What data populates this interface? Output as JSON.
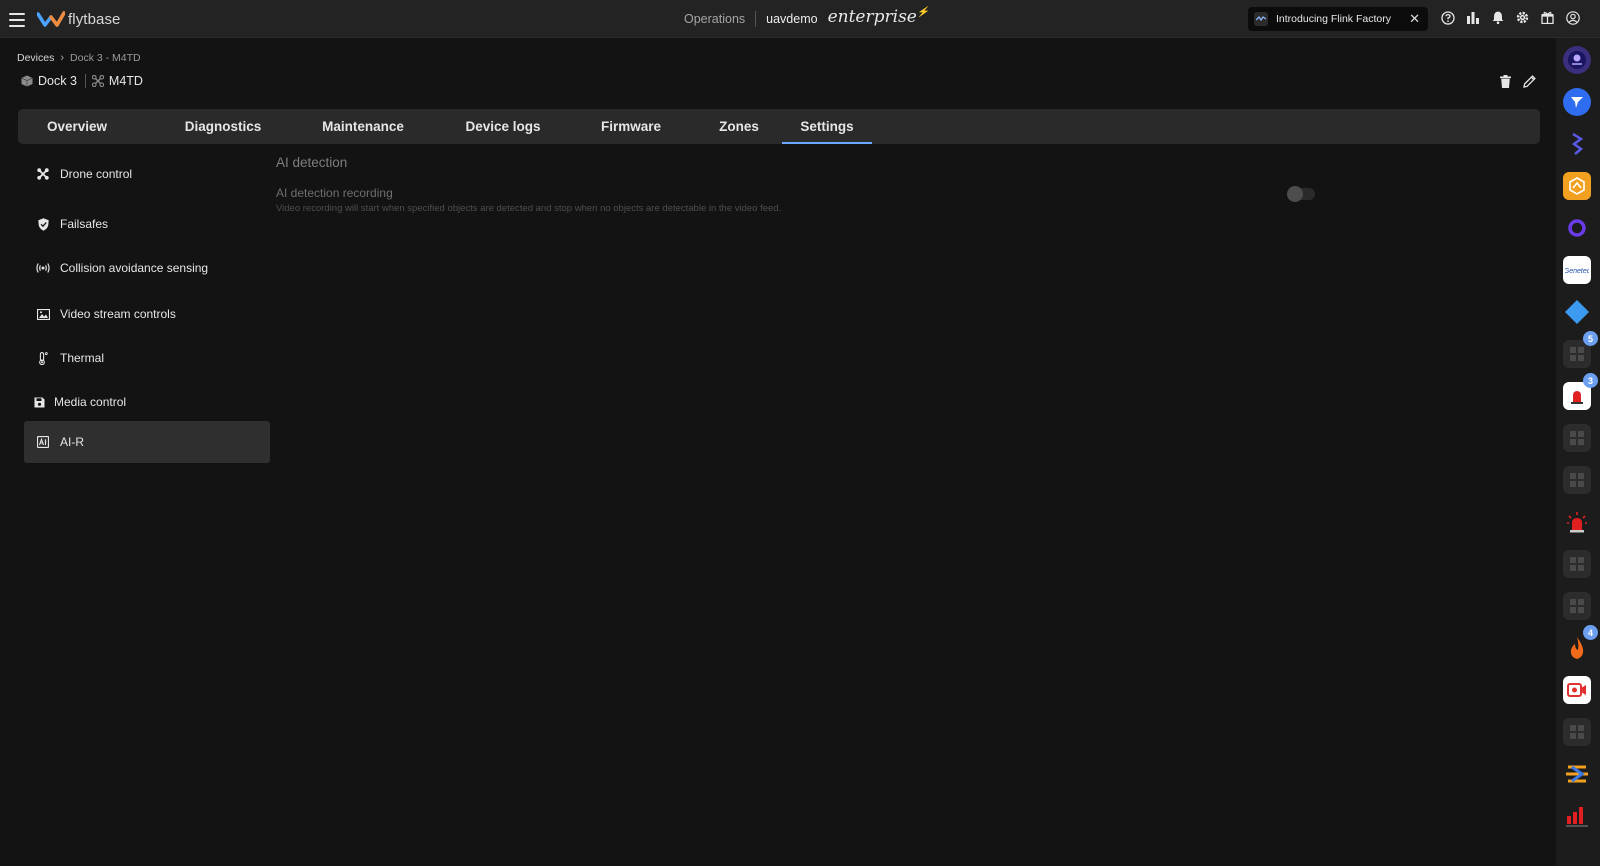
{
  "brand": {
    "name": "flytbase"
  },
  "topbar": {
    "nav_label": "Operations",
    "org_name": "uavdemo",
    "edition": "enterprise",
    "promo_text": "Introducing Flink Factory",
    "promo_close": "✕"
  },
  "breadcrumb": {
    "root": "Devices",
    "separator": "›",
    "current": "Dock 3 - M4TD"
  },
  "device": {
    "dock_name": "Dock 3",
    "drone_name": "M4TD"
  },
  "tabs": [
    {
      "label": "Overview"
    },
    {
      "label": "Diagnostics"
    },
    {
      "label": "Maintenance"
    },
    {
      "label": "Device logs"
    },
    {
      "label": "Firmware"
    },
    {
      "label": "Zones"
    },
    {
      "label": "Settings",
      "active": true
    }
  ],
  "menu": [
    {
      "label": "Drone control",
      "icon": "drone-icon"
    },
    {
      "label": "Failsafes",
      "icon": "shield-icon"
    },
    {
      "label": "Collision avoidance sensing",
      "icon": "radar-icon"
    },
    {
      "label": "Video stream controls",
      "icon": "video-stream-icon"
    },
    {
      "label": "Thermal",
      "icon": "thermometer-icon"
    },
    {
      "label": "Media control",
      "icon": "floppy-icon"
    },
    {
      "label": "AI-R",
      "icon": "ai-icon",
      "active": true
    }
  ],
  "content": {
    "section_title": "AI detection",
    "setting_title": "AI detection recording",
    "setting_desc": "Video recording will start when specified objects are detected and stop when no objects are detectable in the video feed.",
    "toggle_on": false
  },
  "rail": {
    "badges": [
      "5",
      "3",
      "4"
    ]
  },
  "colors": {
    "accent": "#6aa8ff",
    "background": "#131313",
    "topbar": "#232323",
    "tab_bar": "#2a2a2a",
    "badge": "#6c9ff0"
  }
}
